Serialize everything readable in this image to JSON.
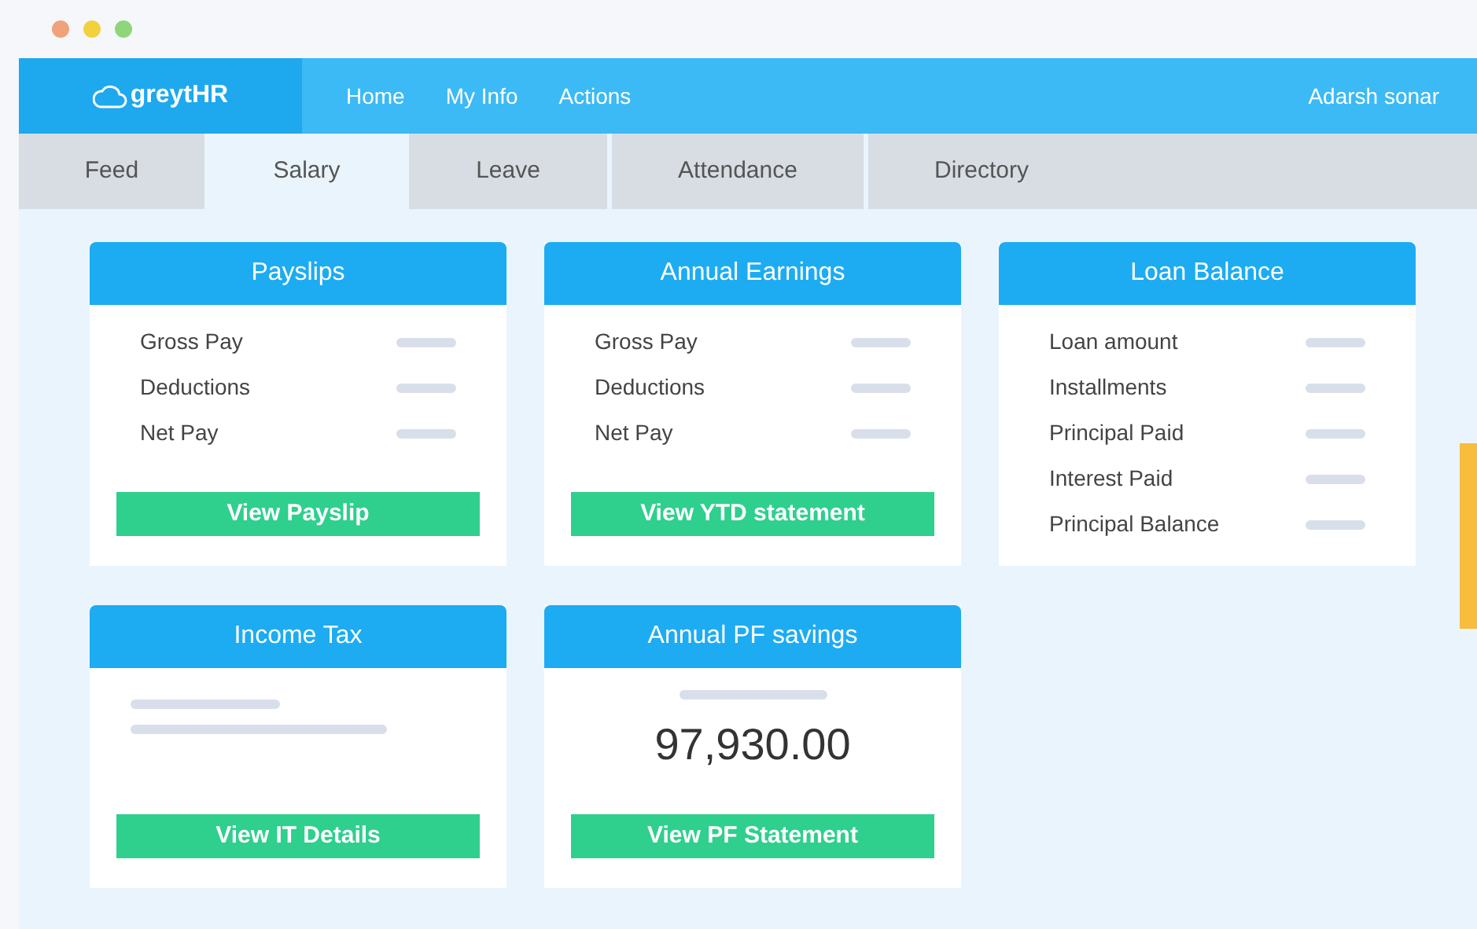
{
  "nav": {
    "logo": "greytHR",
    "links": [
      "Home",
      "My Info",
      "Actions"
    ],
    "user": "Adarsh sonar"
  },
  "tabs": [
    {
      "label": "Feed",
      "selected": false
    },
    {
      "label": "Salary",
      "selected": true
    },
    {
      "label": "Leave",
      "selected": false
    },
    {
      "label": "Attendance",
      "selected": false
    },
    {
      "label": "Directory",
      "selected": false
    }
  ],
  "cards": [
    {
      "kind": "rows",
      "title": "Payslips",
      "rows": [
        "Gross Pay",
        "Deductions",
        "Net Pay"
      ],
      "button": "View Payslip"
    },
    {
      "kind": "rows",
      "title": "Annual Earnings",
      "rows": [
        "Gross Pay",
        "Deductions",
        "Net Pay"
      ],
      "button": "View YTD statement"
    },
    {
      "kind": "rows",
      "title": "Loan Balance",
      "rows": [
        "Loan amount",
        "Installments",
        "Principal Paid",
        "Interest Paid",
        "Principal Balance"
      ]
    },
    {
      "kind": "lines",
      "title": "Income Tax",
      "button": "View IT Details"
    },
    {
      "kind": "amount",
      "title": "Annual PF savings",
      "amount": "97,930.00",
      "button": "View PF Statement"
    }
  ]
}
